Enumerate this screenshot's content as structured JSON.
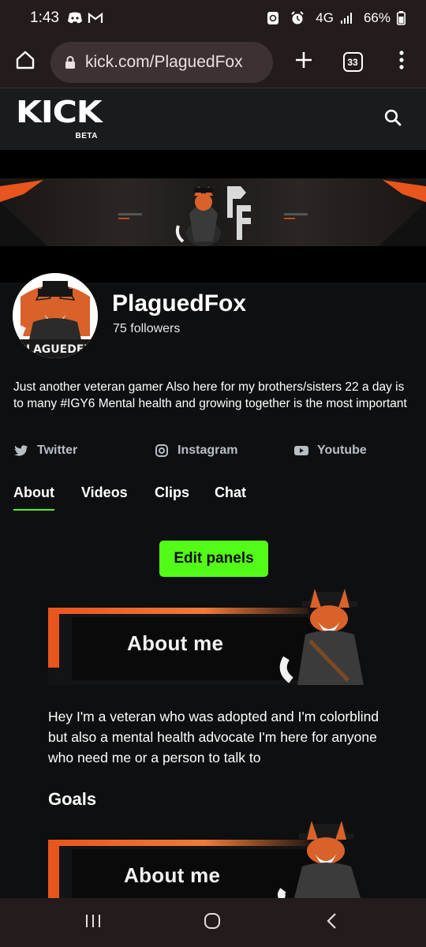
{
  "status_bar": {
    "time": "1:43",
    "network": "4G",
    "battery": "66%",
    "icons": [
      "discord-icon",
      "gmail-icon",
      "alarm-icon",
      "signal-icon",
      "battery-icon"
    ]
  },
  "browser": {
    "url": "kick.com/PlaguedFox",
    "tab_count": "33",
    "icons": [
      "home-icon",
      "lock-icon",
      "new-tab-icon",
      "menu-icon"
    ]
  },
  "site": {
    "logo": "KICK",
    "logo_badge": "BETA",
    "accent_color": "#53fc18",
    "header_color": "#191b1f",
    "bg_color": "#0d0f10"
  },
  "channel": {
    "name": "PlaguedFox",
    "followers": "75 followers",
    "bio": "Just another veteran gamer Also here for my brothers/sisters 22 a day is to many #IGY6 Mental health and growing together is the most important",
    "socials": [
      {
        "label": "Twitter",
        "icon": "twitter-icon"
      },
      {
        "label": "Instagram",
        "icon": "instagram-icon"
      },
      {
        "label": "Youtube",
        "icon": "youtube-icon"
      }
    ],
    "tabs": [
      {
        "label": "About",
        "active": true
      },
      {
        "label": "Videos",
        "active": false
      },
      {
        "label": "Clips",
        "active": false
      },
      {
        "label": "Chat",
        "active": false
      }
    ]
  },
  "about": {
    "edit_button": "Edit panels",
    "panel_title": "About me",
    "panel_title_2": "About me",
    "text": "Hey I'm a veteran who was adopted and I'm colorblind but also a  mental health advocate I'm here for anyone who need me or a person to talk to",
    "goals_heading": "Goals"
  }
}
